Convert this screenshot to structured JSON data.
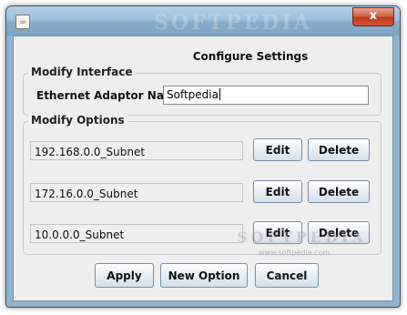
{
  "window": {
    "title_watermark": "SOFTPEDIA",
    "close_label": "x"
  },
  "dialog": {
    "heading": "Configure Settings"
  },
  "modify_interface": {
    "group_title": "Modify Interface",
    "adaptor_label": "Ethernet Adaptor Name",
    "adaptor_value": "Softpedia"
  },
  "modify_options": {
    "group_title": "Modify Options",
    "edit_label": "Edit",
    "delete_label": "Delete",
    "options": [
      "192.168.0.0_Subnet",
      "172.16.0.0_Subnet",
      "10.0.0.0_Subnet"
    ]
  },
  "footer": {
    "apply_label": "Apply",
    "new_option_label": "New Option",
    "cancel_label": "Cancel"
  },
  "watermark": {
    "logo_text": "SOFTPEDIA",
    "url_text": "www.softpedia.com"
  }
}
